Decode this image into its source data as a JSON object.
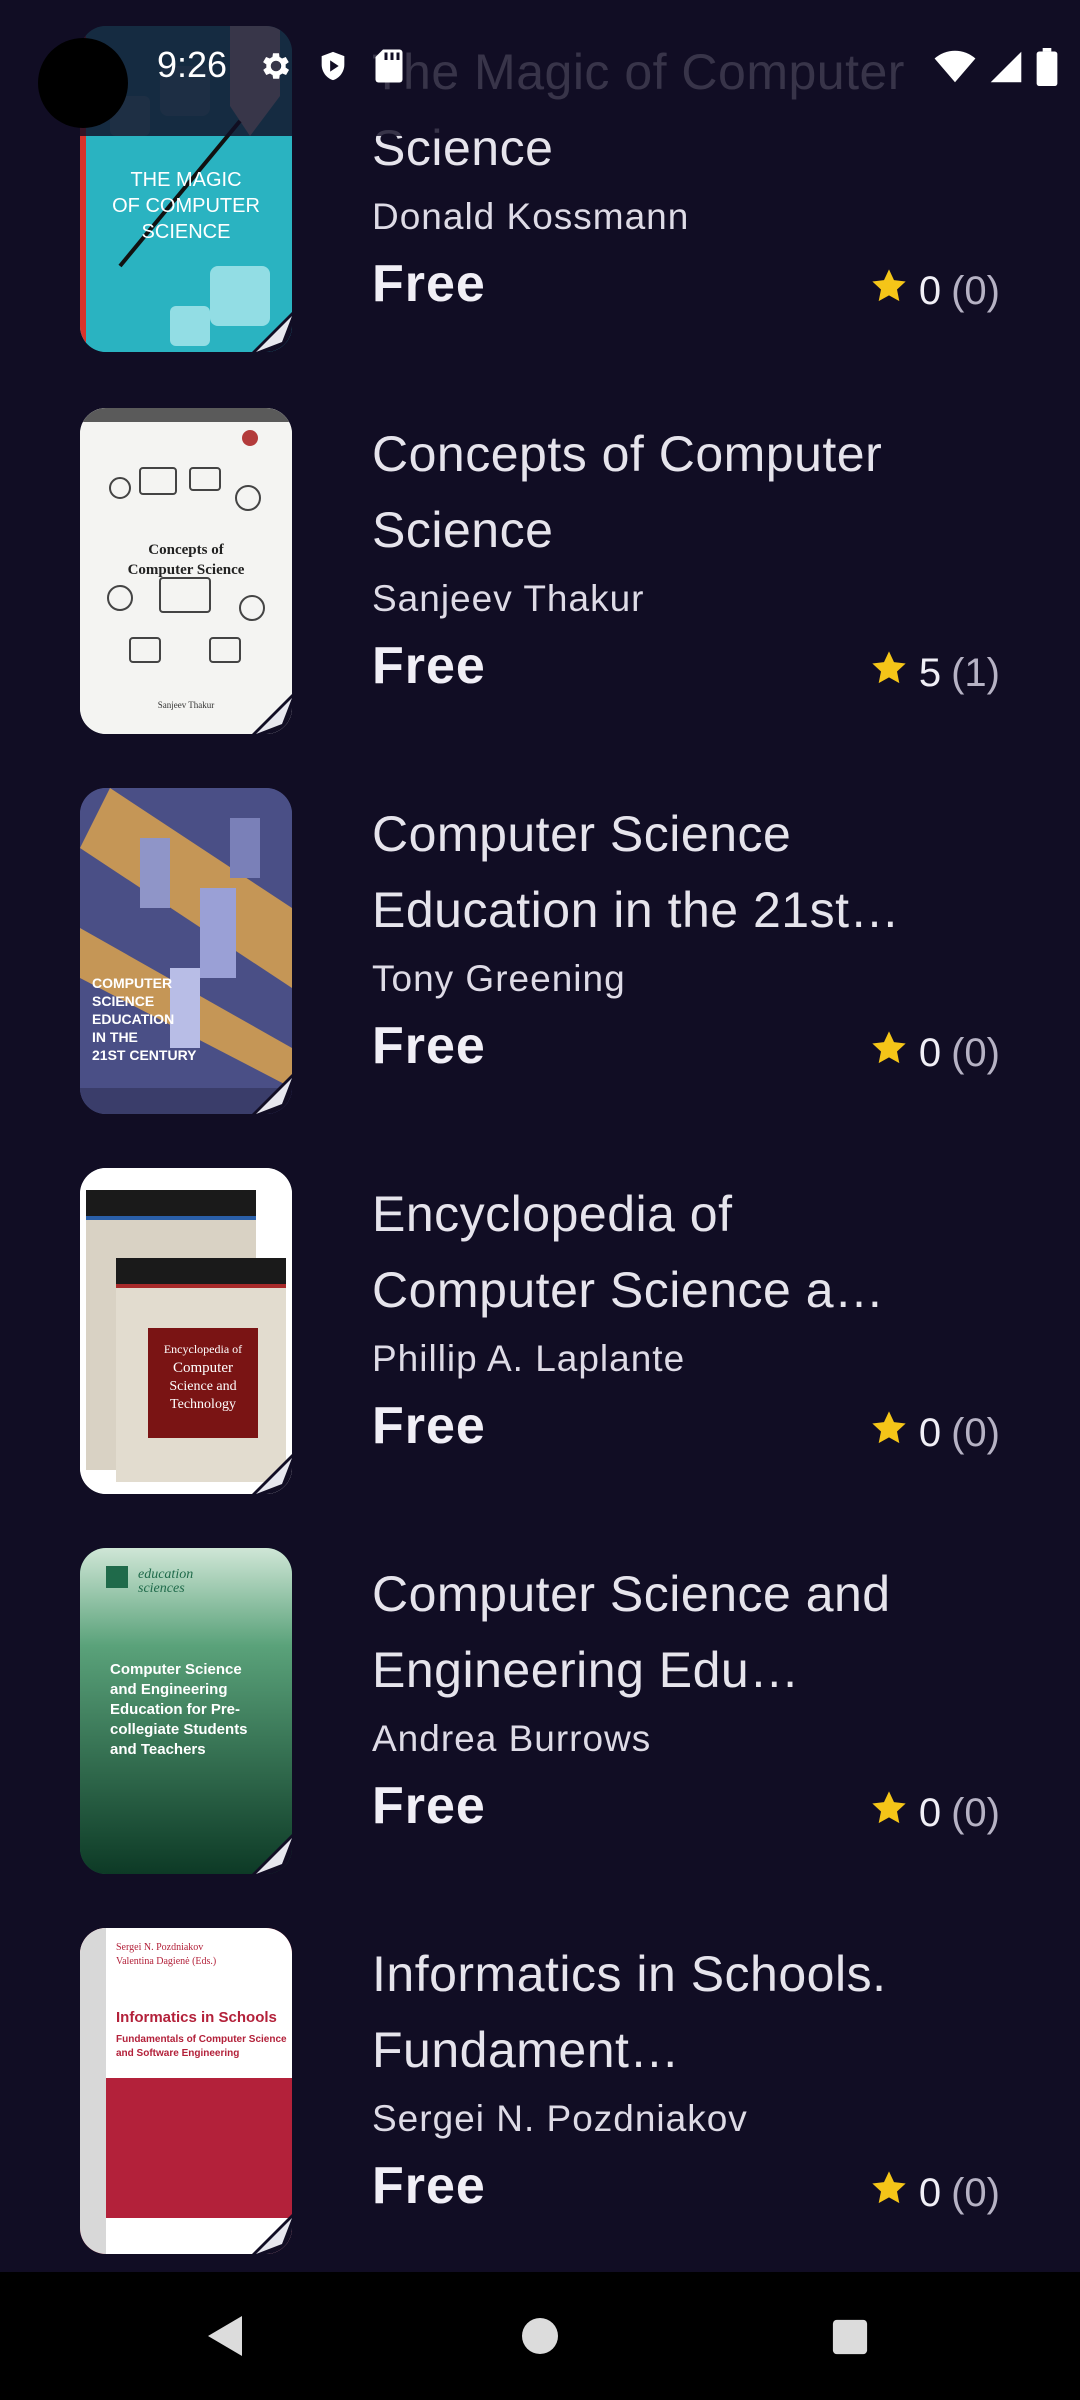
{
  "status_bar": {
    "time": "9:26"
  },
  "books": [
    {
      "title": "The Magic of Computer Science",
      "author": "Donald Kossmann",
      "price": "Free",
      "rating": "0",
      "rating_count": "(0)"
    },
    {
      "title": "Concepts of Computer Science",
      "author": "Sanjeev Thakur",
      "price": "Free",
      "rating": "5",
      "rating_count": "(1)"
    },
    {
      "title": "Computer Science Education in the 21st…",
      "author": "Tony Greening",
      "price": "Free",
      "rating": "0",
      "rating_count": "(0)"
    },
    {
      "title": "Encyclopedia of Computer Science a…",
      "author": "Phillip A. Laplante",
      "price": "Free",
      "rating": "0",
      "rating_count": "(0)"
    },
    {
      "title": "Computer Science and Engineering Edu…",
      "author": "Andrea Burrows",
      "price": "Free",
      "rating": "0",
      "rating_count": "(0)"
    },
    {
      "title": "Informatics in Schools. Fundament…",
      "author": "Sergei N. Pozdniakov",
      "price": "Free",
      "rating": "0",
      "rating_count": "(0)"
    }
  ],
  "covers": [
    {
      "text": "THE MAGIC OF COMPUTER SCIENCE",
      "bg": "#2ab3c1"
    },
    {
      "text": "Concepts of Computer Science",
      "bg": "#f4f4f2"
    },
    {
      "text": "COMPUTER SCIENCE EDUCATION IN THE 21ST CENTURY",
      "bg": "#4a4f86"
    },
    {
      "text": "Encyclopedia of Computer Science and Technology",
      "bg": "#d9d2c4"
    },
    {
      "text": "Computer Science and Engineering Education for Pre-collegiate Students and Teachers",
      "bg": "#1f6a4a"
    },
    {
      "text": "Informatics in Schools",
      "bg": "#b3213a"
    }
  ],
  "colors": {
    "background": "#110d24",
    "star": "#f5c518",
    "nav_bar": "#000000"
  },
  "icons": [
    "settings-icon",
    "shield-icon",
    "sd-card-icon",
    "wifi-icon",
    "signal-icon",
    "battery-icon",
    "star-icon",
    "back-icon",
    "home-icon",
    "recents-icon"
  ]
}
